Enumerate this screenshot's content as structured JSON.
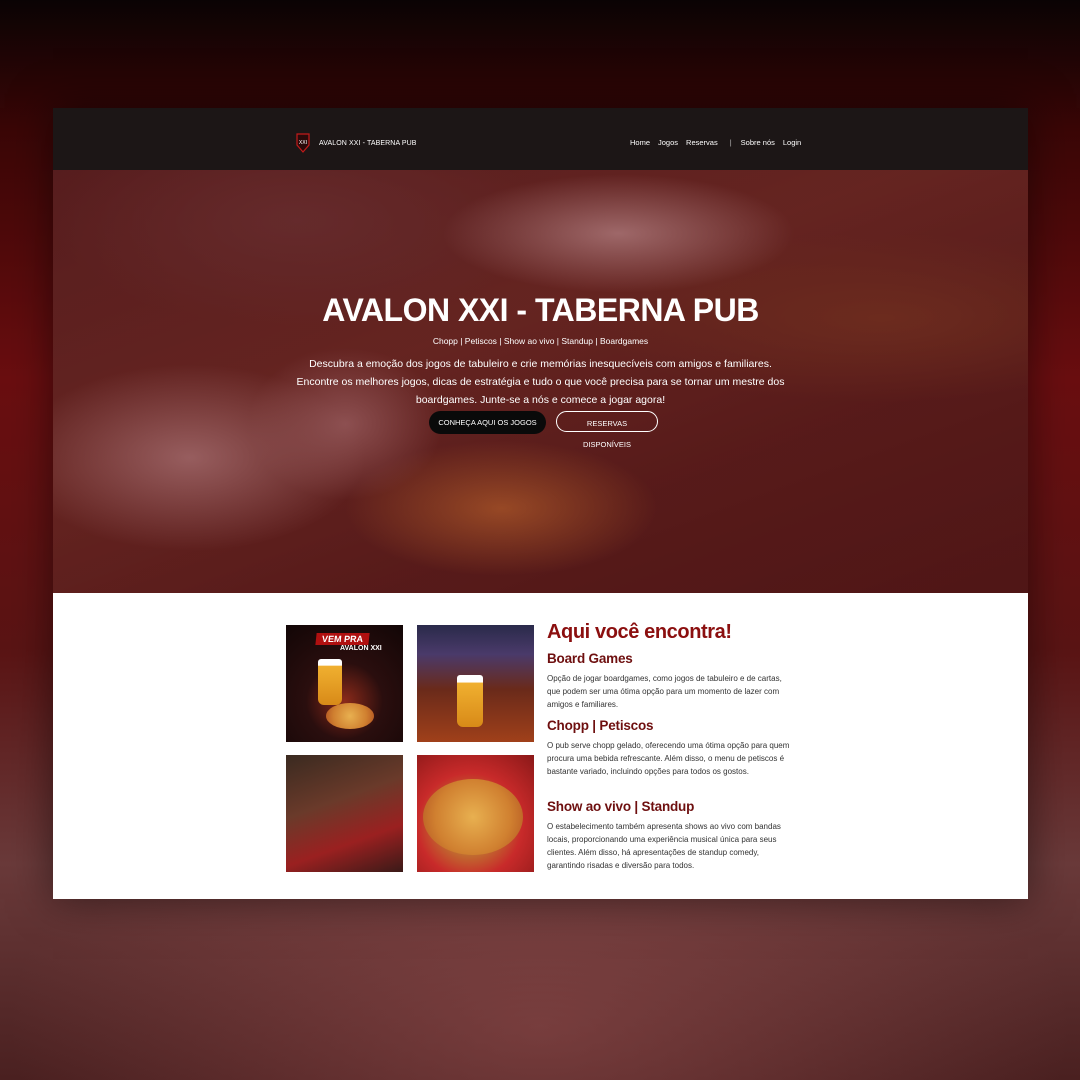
{
  "nav": {
    "brand": "AVALON XXI - TABERNA PUB",
    "links": [
      "Home",
      "Jogos",
      "Reservas",
      "Sobre nós",
      "Login"
    ]
  },
  "hero": {
    "title": "AVALON XXI - TABERNA PUB",
    "subtitle": "Chopp | Petiscos | Show ao vivo | Standup | Boardgames",
    "description": "Descubra a emoção dos jogos de tabuleiro e crie memórias inesquecíveis com amigos e familiares. Encontre os melhores jogos, dicas de estratégia e tudo o que você precisa para se tornar um mestre dos boardgames. Junte-se a nós e comece a jogar agora!",
    "primary_button": "CONHEÇA AQUI OS JOGOS",
    "secondary_button": "RESERVAS DISPONÍVEIS"
  },
  "features": {
    "heading": "Aqui você encontra!",
    "promo_badge": "VEM PRA",
    "promo_brand": "AVALON XXI",
    "items": [
      {
        "title": "Board Games",
        "text": "Opção de jogar boardgames, como jogos de tabuleiro e de cartas, que podem ser uma ótima opção para um momento de lazer com amigos e familiares."
      },
      {
        "title": "Chopp | Petiscos",
        "text": "O pub serve chopp gelado, oferecendo uma ótima opção para quem procura uma bebida refrescante. Além disso, o menu de petiscos é bastante variado, incluindo opções para todos os gostos."
      },
      {
        "title": "Show ao vivo | Standup",
        "text": "O estabelecimento também apresenta shows ao vivo com bandas locais, proporcionando uma experiência musical única para seus clientes. Além disso, há apresentações de standup comedy, garantindo risadas e diversão para todos."
      }
    ]
  },
  "colors": {
    "accent": "#8b0f0f",
    "nav_bg": "#1c1616",
    "hero_overlay": "#6e1214"
  }
}
